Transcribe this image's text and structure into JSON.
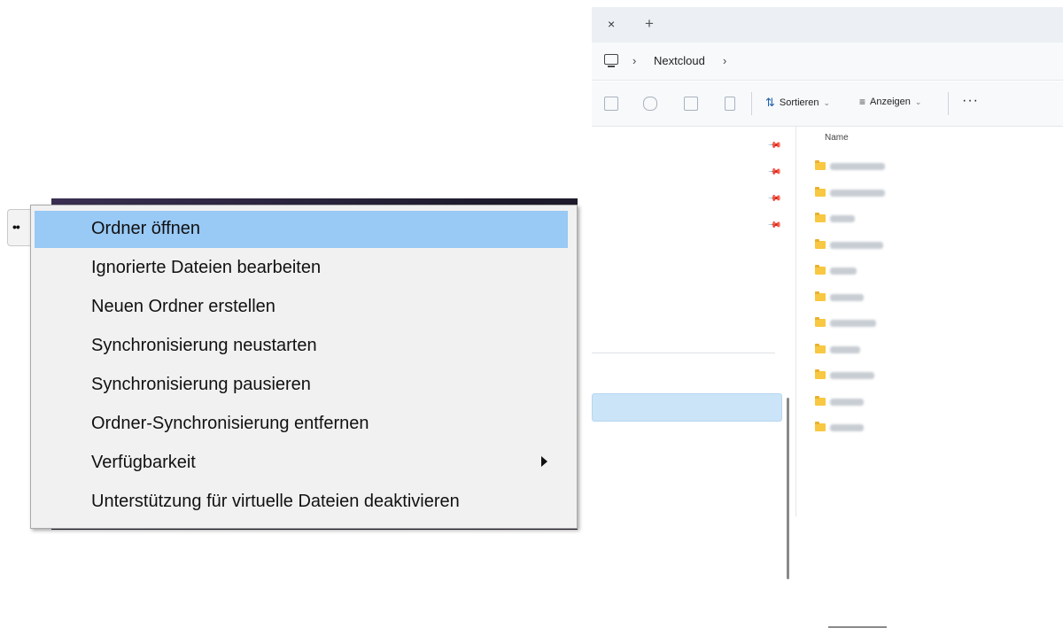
{
  "explorer": {
    "tab": {
      "close_glyph": "×",
      "add_glyph": "+"
    },
    "address": {
      "icon": "computer-icon",
      "separator": "›",
      "crumb": "Nextcloud"
    },
    "toolbar": {
      "sort_label": "Sortieren",
      "view_label": "Anzeigen",
      "more_label": "···",
      "icons": [
        "paste-icon",
        "rename-icon",
        "share-icon",
        "delete-icon"
      ]
    },
    "file_list": {
      "column_name": "Name",
      "folder_count": 11
    }
  },
  "context_menu": {
    "items": [
      {
        "label": "Ordner öffnen",
        "highlighted": true
      },
      {
        "label": "Ignorierte Dateien bearbeiten"
      },
      {
        "label": "Neuen Ordner erstellen"
      },
      {
        "label": "Synchronisierung neustarten"
      },
      {
        "label": "Synchronisierung pausieren"
      },
      {
        "label": "Ordner-Synchronisierung entfernen"
      },
      {
        "label": "Verfügbarkeit",
        "submenu": true
      },
      {
        "label": "Unterstützung für virtuelle Dateien deaktivieren"
      }
    ]
  },
  "colors": {
    "menu_highlight": "#99c9f5",
    "menu_background": "#f1f1f1",
    "nav_selected": "#cce4f7",
    "folder": "#f8c842"
  }
}
